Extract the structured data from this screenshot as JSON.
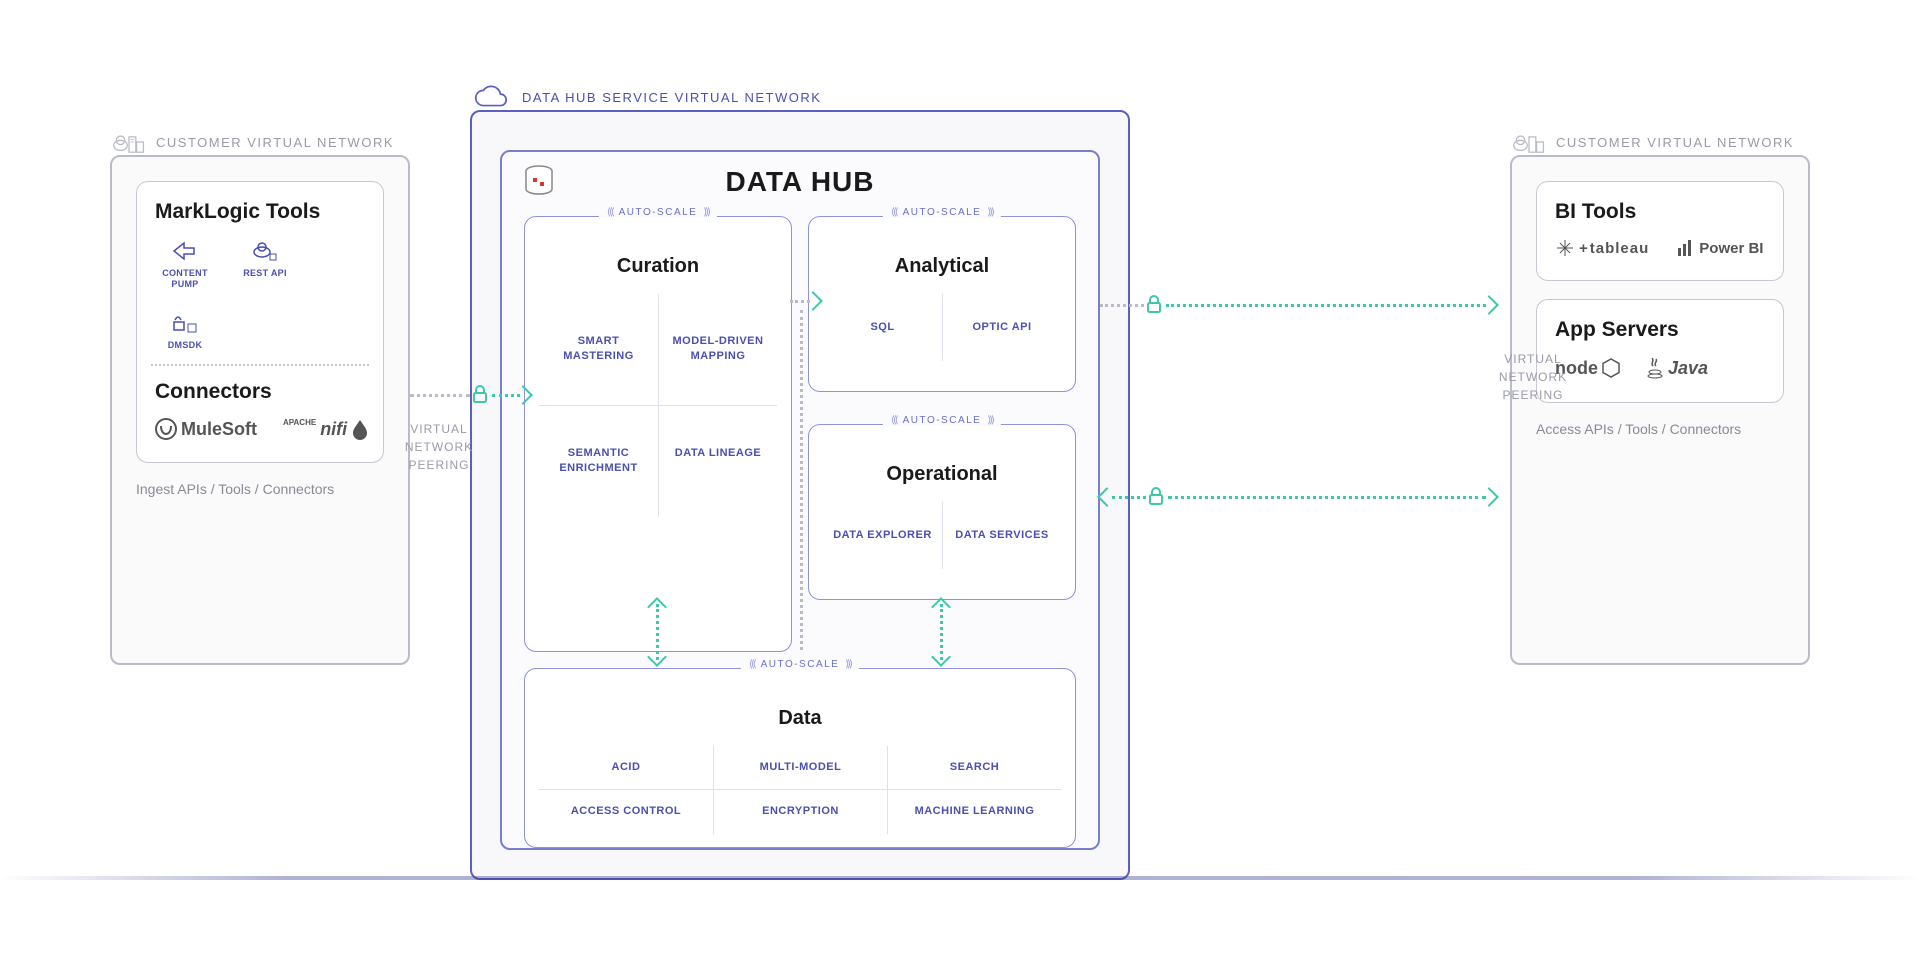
{
  "stage": {
    "left_customer": {
      "label": "CUSTOMER VIRTUAL NETWORK",
      "tools_card": {
        "title": "MarkLogic Tools",
        "items": [
          {
            "label": "CONTENT PUMP"
          },
          {
            "label": "REST API"
          },
          {
            "label": "DMSDK"
          }
        ]
      },
      "connectors_card": {
        "title": "Connectors",
        "vendors": [
          "MuleSoft",
          "nifi"
        ]
      },
      "footer": "Ingest APIs / Tools / Connectors"
    },
    "right_customer": {
      "label": "CUSTOMER VIRTUAL NETWORK",
      "bi_card": {
        "title": "BI Tools",
        "vendors": [
          "tableau",
          "Power BI"
        ]
      },
      "app_card": {
        "title": "App Servers",
        "vendors": [
          "node",
          "Java"
        ]
      },
      "footer": "Access APIs / Tools / Connectors"
    },
    "data_hub": {
      "outer_label": "DATA HUB SERVICE VIRTUAL NETWORK",
      "title": "DATA HUB",
      "autoscale": "AUTO-SCALE",
      "curation": {
        "title": "Curation",
        "feats": [
          "SMART MASTERING",
          "MODEL-DRIVEN MAPPING",
          "SEMANTIC ENRICHMENT",
          "DATA LINEAGE"
        ]
      },
      "analytical": {
        "title": "Analytical",
        "feats": [
          "SQL",
          "OPTIC API"
        ]
      },
      "operational": {
        "title": "Operational",
        "feats": [
          "DATA EXPLORER",
          "DATA SERVICES"
        ]
      },
      "data": {
        "title": "Data",
        "feats": [
          "ACID",
          "MULTI-MODEL",
          "SEARCH",
          "ACCESS CONTROL",
          "ENCRYPTION",
          "MACHINE LEARNING"
        ]
      }
    },
    "peering": "VIRTUAL NETWORK PEERING"
  }
}
